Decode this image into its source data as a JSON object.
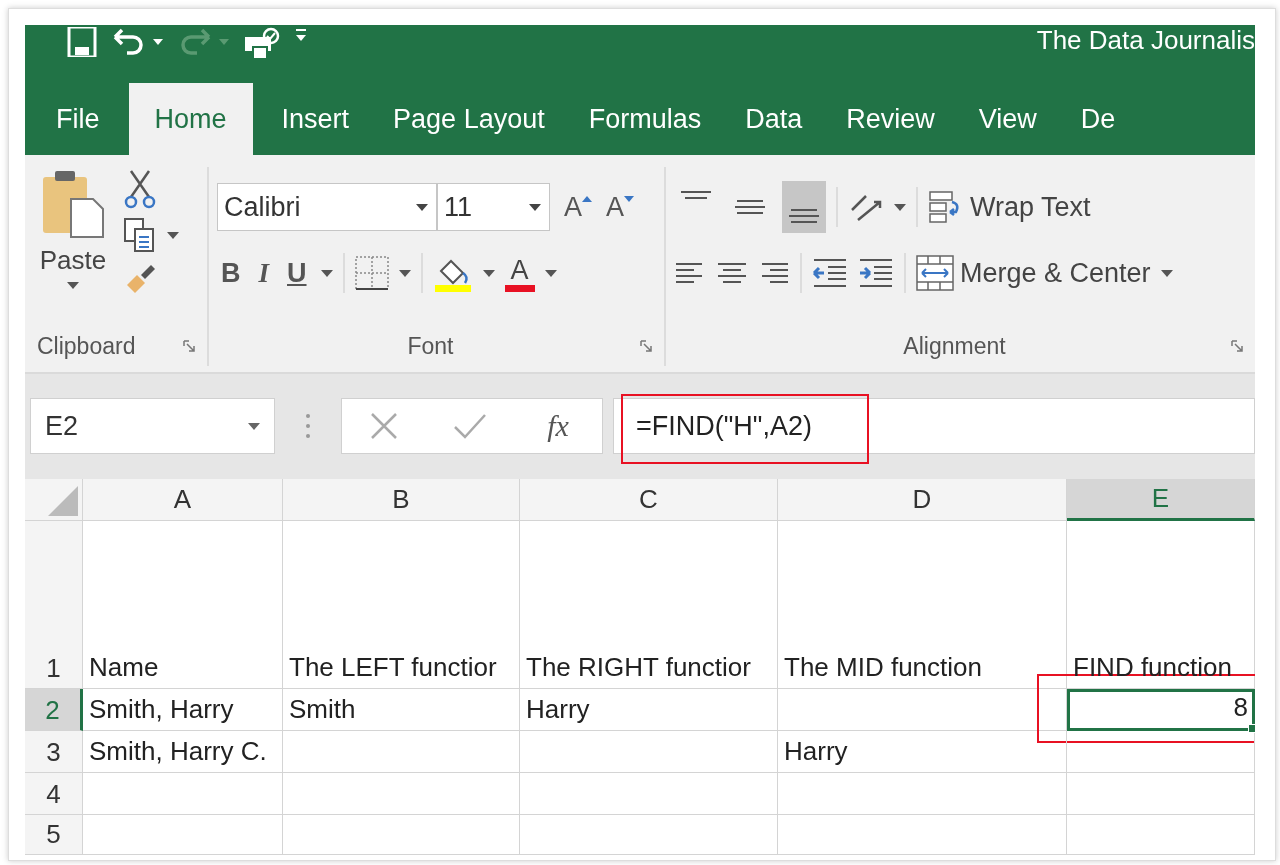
{
  "title_bar": {
    "title": "The Data Journalis"
  },
  "tabs": [
    {
      "label": "File",
      "selected": false
    },
    {
      "label": "Home",
      "selected": true
    },
    {
      "label": "Insert",
      "selected": false
    },
    {
      "label": "Page Layout",
      "selected": false
    },
    {
      "label": "Formulas",
      "selected": false
    },
    {
      "label": "Data",
      "selected": false
    },
    {
      "label": "Review",
      "selected": false
    },
    {
      "label": "View",
      "selected": false
    },
    {
      "label": "De",
      "selected": false
    }
  ],
  "clipboard": {
    "paste": "Paste",
    "label": "Clipboard"
  },
  "font": {
    "name": "Calibri",
    "size": "11",
    "grow": "A",
    "shrink": "A",
    "bold": "B",
    "italic": "I",
    "underline": "U",
    "color_letter": "A",
    "label": "Font"
  },
  "alignment": {
    "vertical": [
      {
        "selected": false
      },
      {
        "selected": false
      },
      {
        "selected": true
      }
    ],
    "wrap": "Wrap Text",
    "merge": "Merge & Center",
    "label": "Alignment"
  },
  "formula_bar": {
    "name_box": "E2",
    "fx": "fx",
    "formula": "=FIND(\"H\",A2)",
    "highlighted": true
  },
  "sheet": {
    "columns": [
      {
        "label": "A",
        "selected": false
      },
      {
        "label": "B",
        "selected": false
      },
      {
        "label": "C",
        "selected": false
      },
      {
        "label": "D",
        "selected": false
      },
      {
        "label": "E",
        "selected": true
      }
    ],
    "rows": [
      {
        "number": "1",
        "selected": false,
        "cells": [
          {
            "kind": "text",
            "text": "Name",
            "selected": false
          },
          {
            "kind": "text",
            "text": "The LEFT functior",
            "selected": false
          },
          {
            "kind": "text",
            "text": "The RIGHT functior",
            "selected": false
          },
          {
            "kind": "text",
            "text": "The MID function",
            "selected": false
          },
          {
            "kind": "text",
            "text": "FIND function",
            "selected": false
          }
        ]
      },
      {
        "number": "2",
        "selected": true,
        "cells": [
          {
            "kind": "text",
            "text": "Smith, Harry",
            "selected": false
          },
          {
            "kind": "text",
            "text": "Smith",
            "selected": false
          },
          {
            "kind": "text",
            "text": "Harry",
            "selected": false
          },
          {
            "kind": "blank",
            "selected": false
          },
          {
            "kind": "number",
            "text": "8",
            "selected": true,
            "highlighted": true
          }
        ]
      },
      {
        "number": "3",
        "selected": false,
        "cells": [
          {
            "kind": "text",
            "text": "Smith, Harry C.",
            "selected": false
          },
          {
            "kind": "blank",
            "selected": false
          },
          {
            "kind": "blank",
            "selected": false
          },
          {
            "kind": "text",
            "text": "Harry",
            "selected": false
          },
          {
            "kind": "blank",
            "selected": false
          }
        ]
      },
      {
        "number": "4",
        "selected": false,
        "cells": [
          {
            "kind": "blank",
            "selected": false
          },
          {
            "kind": "blank",
            "selected": false
          },
          {
            "kind": "blank",
            "selected": false
          },
          {
            "kind": "blank",
            "selected": false
          },
          {
            "kind": "blank",
            "selected": false
          }
        ]
      },
      {
        "number": "5",
        "selected": false,
        "cells": [
          {
            "kind": "blank",
            "selected": false
          },
          {
            "kind": "blank",
            "selected": false
          },
          {
            "kind": "blank",
            "selected": false
          },
          {
            "kind": "blank",
            "selected": false
          },
          {
            "kind": "blank",
            "selected": false
          }
        ]
      }
    ]
  }
}
